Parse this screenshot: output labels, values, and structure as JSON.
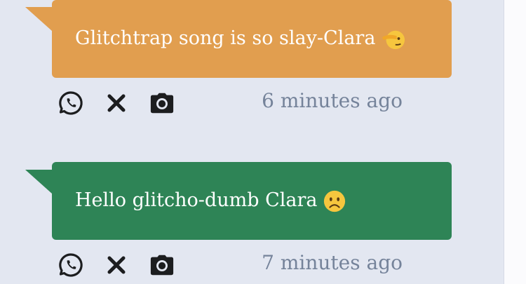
{
  "messages": [
    {
      "text": "Glitchtrap song is so slay-Clara",
      "emoji": "saluting-face-emoji",
      "bubble_color": "#e19e4f",
      "time": "6 minutes ago"
    },
    {
      "text": "Hello glitcho-dumb Clara",
      "emoji": "frowning-face-emoji",
      "bubble_color": "#2e8456",
      "time": "7 minutes ago"
    }
  ],
  "actions": {
    "whatsapp_icon": "whatsapp-icon",
    "x_icon": "x-icon",
    "camera_icon": "camera-icon"
  },
  "colors": {
    "background": "#e3e7f1",
    "timestamp": "#75839a",
    "icon": "#1c1d1f"
  }
}
